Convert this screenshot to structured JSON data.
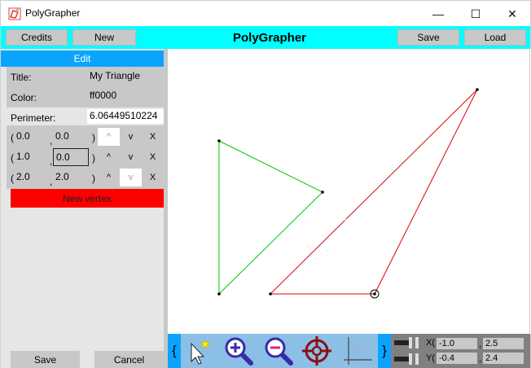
{
  "window": {
    "title": "PolyGrapher",
    "minimize": "—",
    "maximize": "☐",
    "close": "✕"
  },
  "toolbar": {
    "credits": "Credits",
    "new": "New",
    "title": "PolyGrapher",
    "save": "Save",
    "load": "Load"
  },
  "edit": {
    "header": "Edit",
    "title_label": "Title:",
    "title_value": "My Triangle",
    "color_label": "Color:",
    "color_value": "ff0000",
    "perimeter_label": "Perimeter:",
    "perimeter_value": "6.06449510224",
    "vertices": [
      {
        "x": "0.0",
        "y": "0.0",
        "up": "^",
        "down": "v",
        "del": "X"
      },
      {
        "x": "1.0",
        "y": "0.0",
        "up": "^",
        "down": "v",
        "del": "X"
      },
      {
        "x": "2.0",
        "y": "2.0",
        "up": "^",
        "down": "v",
        "del": "X"
      }
    ],
    "paren_open": "(",
    "comma": ",",
    "paren_close": ")",
    "new_vertex": "New vertex",
    "save": "Save",
    "cancel": "Cancel"
  },
  "tools": {
    "brace_open": "{",
    "brace_close": "}",
    "icons": [
      "select-pointer-icon",
      "zoom-in-icon",
      "zoom-out-icon",
      "crosshair-icon",
      "grid-icon"
    ]
  },
  "coords": {
    "x_label": "X(",
    "x_min": "-1.0",
    "x_max": "2.5",
    "y_label": "Y(",
    "y_min": "-0.4",
    "y_max": "2.4",
    "comma": ","
  },
  "colors": {
    "accent": "#00ffff",
    "edit_bar": "#0aa4ff",
    "new_vertex": "#ff0000",
    "green_polygon": "#00cc00",
    "red_polygon": "#dd0000"
  }
}
